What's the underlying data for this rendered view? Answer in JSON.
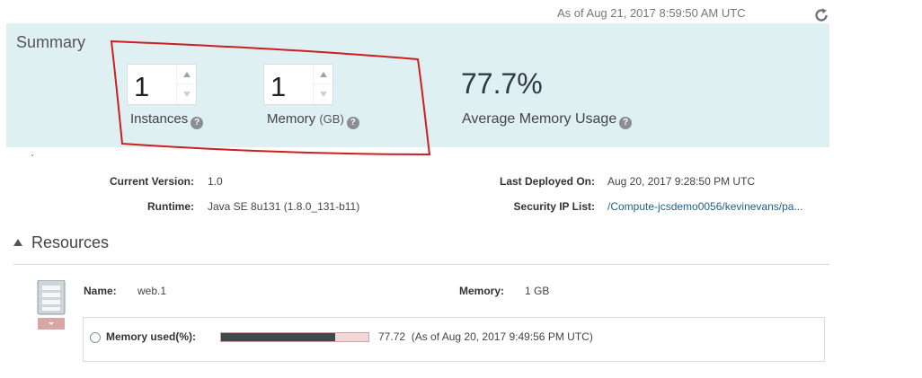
{
  "header": {
    "as_of": "As of Aug 21, 2017 8:59:50 AM UTC",
    "refresh_icon": "refresh-icon"
  },
  "summary": {
    "title": "Summary",
    "instances": {
      "value": "1",
      "label": "Instances",
      "help_icon": "help-icon"
    },
    "memory": {
      "value": "1",
      "label": "Memory",
      "unit": "(GB)",
      "help_icon": "help-icon"
    },
    "avg_memory": {
      "value": "77.7%",
      "label": "Average Memory Usage",
      "help_icon": "help-icon"
    },
    "stray_mark": "`"
  },
  "details": {
    "current_version": {
      "label": "Current Version:",
      "value": "1.0"
    },
    "runtime": {
      "label": "Runtime:",
      "value": "Java SE 8u131 (1.8.0_131-b11)"
    },
    "last_deployed": {
      "label": "Last Deployed On:",
      "value": "Aug 20, 2017 9:28:50 PM UTC"
    },
    "security_ip": {
      "label": "Security IP List:",
      "value": "/Compute-jcsdemo0056/kevinevans/pa..."
    }
  },
  "resources": {
    "title": "Resources",
    "instance": {
      "name_label": "Name:",
      "name_value": "web.1",
      "memory_label": "Memory:",
      "memory_value": "1 GB",
      "mem_used_label": "Memory used(%):",
      "mem_used_value": "77.72",
      "mem_used_fraction": 0.7772,
      "mem_used_asof": "(As of Aug 20, 2017 9:49:56 PM UTC)"
    }
  },
  "colors": {
    "summary_bg": "#dff0f3",
    "annotation": "#cc1f1f",
    "link": "#1f5f8b",
    "bar_fill": "#3c4b49",
    "bar_track": "#f3d6d8"
  }
}
